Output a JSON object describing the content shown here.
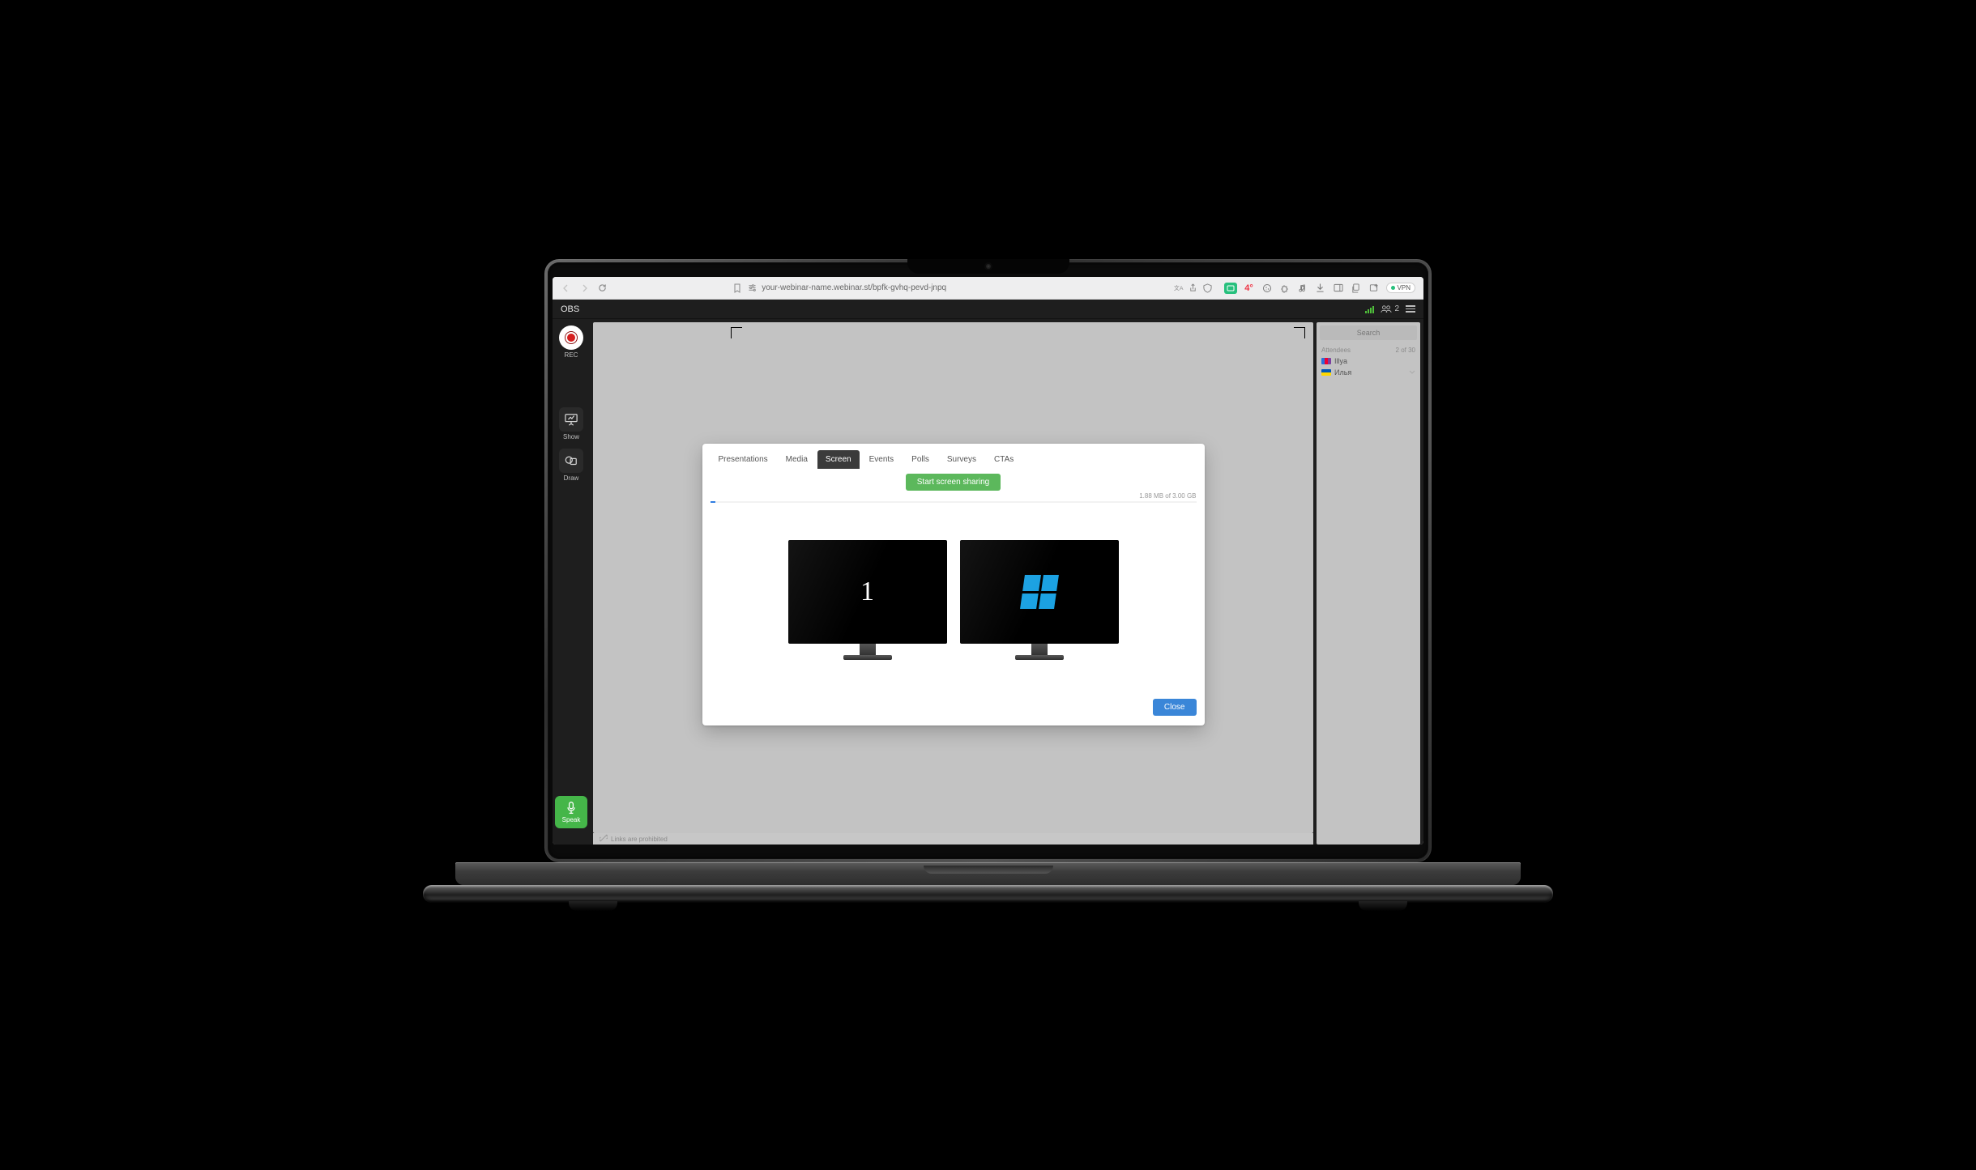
{
  "browser": {
    "url": "your-webinar-name.webinar.st/bpfk-gvhq-pevd-jnpq",
    "badge_temp": "4°",
    "vpn_label": "VPN"
  },
  "header": {
    "app_name": "OBS",
    "user_count": "2"
  },
  "left_rail": {
    "rec_label": "REC",
    "show_label": "Show",
    "draw_label": "Draw",
    "speak_label": "Speak"
  },
  "status_bar": {
    "links_msg": "Links are prohibited"
  },
  "side_panel": {
    "search_placeholder": "Search",
    "attendees_label": "Attendees",
    "attendees_count": "2 of 30",
    "items": [
      {
        "name": "Illya"
      },
      {
        "name": "Илья"
      }
    ]
  },
  "modal": {
    "tabs": [
      "Presentations",
      "Media",
      "Screen",
      "Events",
      "Polls",
      "Surveys",
      "CTAs"
    ],
    "active_tab_index": 2,
    "start_label": "Start screen sharing",
    "storage_text": "1.88 MB of 3.00 GB",
    "storage_fill_pct": 1,
    "monitors": {
      "first_label": "1"
    },
    "close_label": "Close"
  }
}
